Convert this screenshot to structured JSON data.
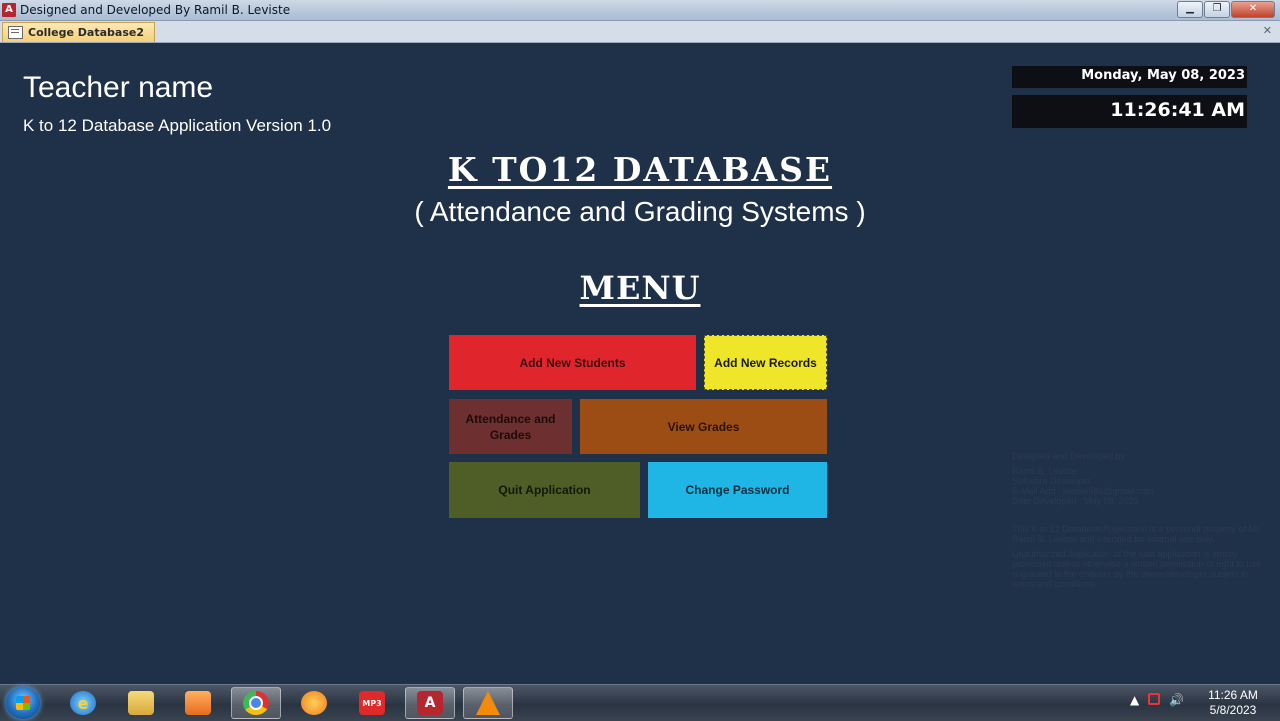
{
  "window": {
    "title": "Designed and Developed By Ramil B. Leviste",
    "app_icon_letter": "A",
    "minimize_glyph": "▁",
    "maximize_glyph": "❐",
    "close_glyph": "✕"
  },
  "document_tab": {
    "label": "College Database2",
    "close_glyph": "✕"
  },
  "header": {
    "teacher_name": "Teacher name",
    "version": "K to 12 Database Application Version 1.0",
    "date": "Monday, May 08, 2023",
    "time": "11:26:41 AM"
  },
  "main": {
    "title": "K TO12 DATABASE",
    "subtitle": "( Attendance and Grading Systems )",
    "menu_title": "MENU"
  },
  "menu_buttons": {
    "add_new_students": "Add New Students",
    "add_new_records": "Add New Records",
    "attendance_and_grades": "Attendance and Grades",
    "view_grades": "View Grades",
    "quit_application": "Quit Application",
    "change_password": "Change Password"
  },
  "credits": {
    "line1": "Designed and Developed by",
    "line2": "Ramil B. Leviste",
    "line3": "Software Developer",
    "line4": "E-Mail Add : leviste581@gmail.com",
    "line5": "Date Developed : May 08, 2023",
    "para1": "This K to 12 Database Application is a personal property of Mr. Ramil B. Leviste and intended for internal use only.",
    "para2": "Unauthorized duplication of the said application is strictly prohibited unless otherwise a written permission or right to use is granted to the enduser by the owner/developer subject to terms and conditions."
  },
  "taskbar": {
    "ie_glyph": "e",
    "mp3_label": "MP3",
    "access_label": "A",
    "tray_arrow": "▲",
    "tray_volume": "🔊",
    "clock_time": "11:26 AM",
    "clock_date": "5/8/2023"
  },
  "colors": {
    "form_background": "#1f3049",
    "add_new_students": "#e0262c",
    "add_new_records": "#efe62a",
    "attendance_and_grades": "#6e2f31",
    "view_grades": "#9c4d14",
    "quit_application": "#4e5e26",
    "change_password": "#1fb6e6"
  }
}
